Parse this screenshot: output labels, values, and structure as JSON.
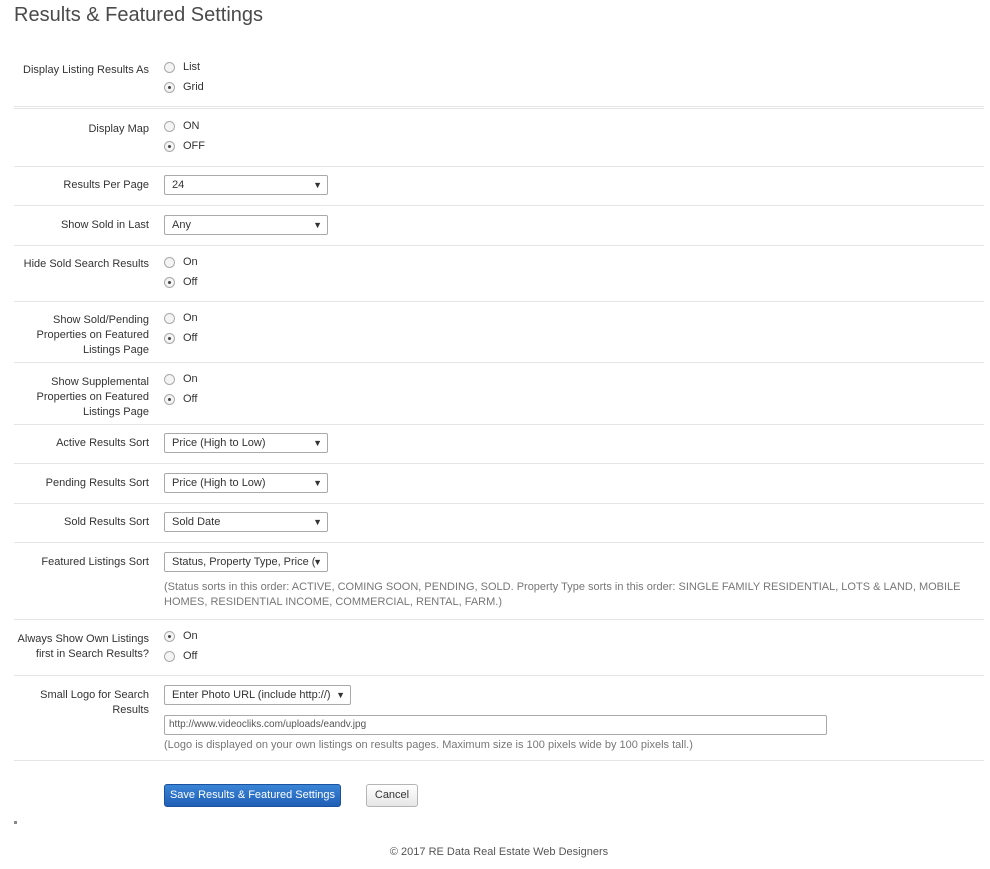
{
  "page_title": "Results & Featured Settings",
  "settings": {
    "display_listing_results_as": {
      "label": "Display Listing Results As",
      "options": [
        "List",
        "Grid"
      ],
      "selected": "Grid"
    },
    "display_map": {
      "label": "Display Map",
      "options": [
        "ON",
        "OFF"
      ],
      "selected": "OFF"
    },
    "results_per_page": {
      "label": "Results Per Page",
      "value": "24"
    },
    "show_sold_in_last": {
      "label": "Show Sold in Last",
      "value": "Any"
    },
    "hide_sold_search_results": {
      "label": "Hide Sold Search Results",
      "options": [
        "On",
        "Off"
      ],
      "selected": "Off"
    },
    "show_sold_pending": {
      "label": "Show Sold/Pending Properties on Featured Listings Page",
      "options": [
        "On",
        "Off"
      ],
      "selected": "Off"
    },
    "show_supplemental": {
      "label": "Show Supplemental Properties on Featured Listings Page",
      "options": [
        "On",
        "Off"
      ],
      "selected": "Off"
    },
    "active_results_sort": {
      "label": "Active Results Sort",
      "value": "Price (High to Low)"
    },
    "pending_results_sort": {
      "label": "Pending Results Sort",
      "value": "Price (High to Low)"
    },
    "sold_results_sort": {
      "label": "Sold Results Sort",
      "value": "Sold Date"
    },
    "featured_listings_sort": {
      "label": "Featured Listings Sort",
      "value": "Status, Property Type, Price (",
      "note": "(Status sorts in this order: ACTIVE, COMING SOON, PENDING, SOLD. Property Type sorts in this order: SINGLE FAMILY RESIDENTIAL, LOTS & LAND, MOBILE HOMES, RESIDENTIAL INCOME, COMMERCIAL, RENTAL, FARM.)"
    },
    "always_show_own_listings": {
      "label": "Always Show Own Listings first in Search Results?",
      "options": [
        "On",
        "Off"
      ],
      "selected": "On"
    },
    "small_logo": {
      "label": "Small Logo for Search Results",
      "value": "Enter Photo URL (include http://)",
      "url": "http://www.videocliks.com/uploads/eandv.jpg",
      "note": "(Logo is displayed on your own listings on results pages. Maximum size is 100 pixels wide by 100 pixels tall.)"
    }
  },
  "buttons": {
    "save": "Save Results & Featured Settings",
    "cancel": "Cancel"
  },
  "footer": "© 2017 RE Data Real Estate Web Designers",
  "icons": {
    "dropdown": "▼"
  }
}
